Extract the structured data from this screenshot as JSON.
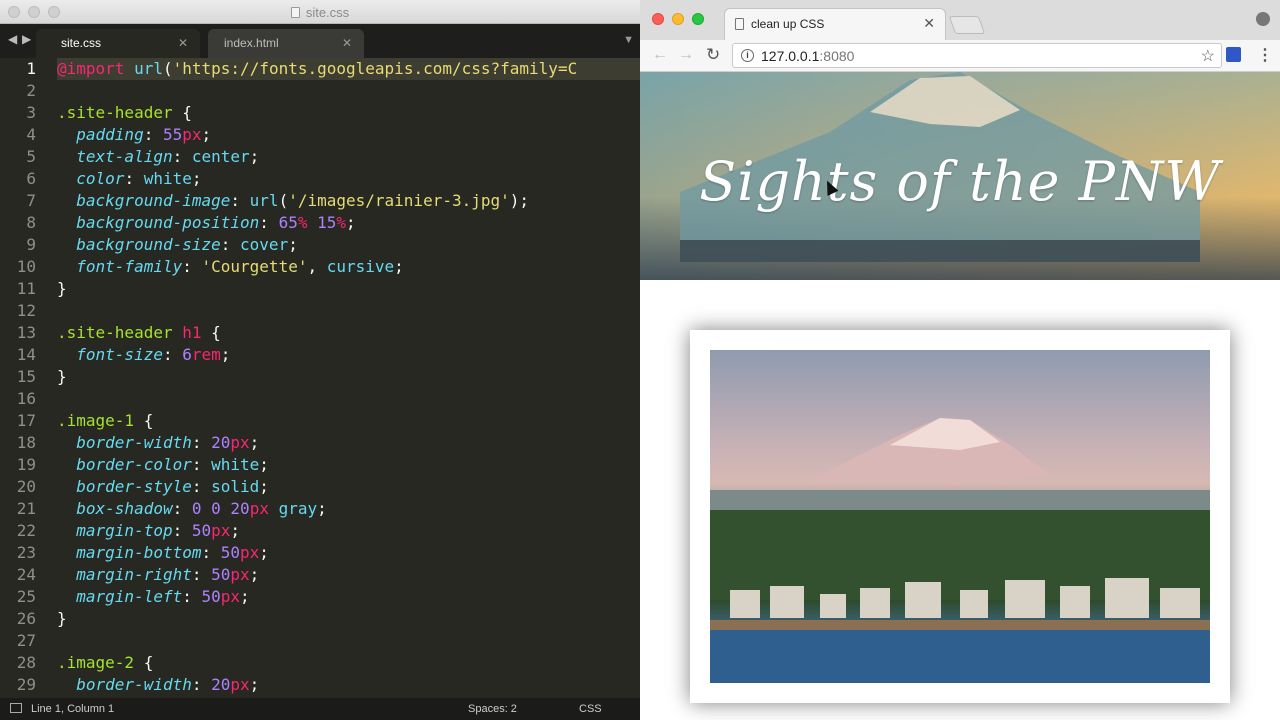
{
  "editor": {
    "window_title": "site.css",
    "tabs": [
      {
        "label": "site.css",
        "active": true
      },
      {
        "label": "index.html",
        "active": false
      }
    ],
    "line_numbers": [
      "1",
      "2",
      "3",
      "4",
      "5",
      "6",
      "7",
      "8",
      "9",
      "10",
      "11",
      "12",
      "13",
      "14",
      "15",
      "16",
      "17",
      "18",
      "19",
      "20",
      "21",
      "22",
      "23",
      "24",
      "25",
      "26",
      "27",
      "28",
      "29"
    ],
    "status": {
      "position": "Line 1, Column 1",
      "spaces": "Spaces: 2",
      "syntax": "CSS"
    }
  },
  "browser": {
    "tab_title": "clean up CSS",
    "url_host": "127.0.0.1",
    "url_port": ":8080",
    "site_title": "Sights of the PNW"
  },
  "colors": {
    "editor_bg": "#272822",
    "selector": "#a6e22e",
    "property": "#66d9ef",
    "number": "#ae81ff",
    "keyword": "#f92672",
    "string": "#e6db74"
  },
  "icons": [
    "back-arrow-icon",
    "forward-arrow-icon",
    "close-icon",
    "chevron-down-icon",
    "reload-icon",
    "info-icon",
    "star-icon",
    "extension-icon",
    "menu-dots-icon",
    "profile-icon",
    "page-icon",
    "panel-icon",
    "cursor-icon"
  ]
}
